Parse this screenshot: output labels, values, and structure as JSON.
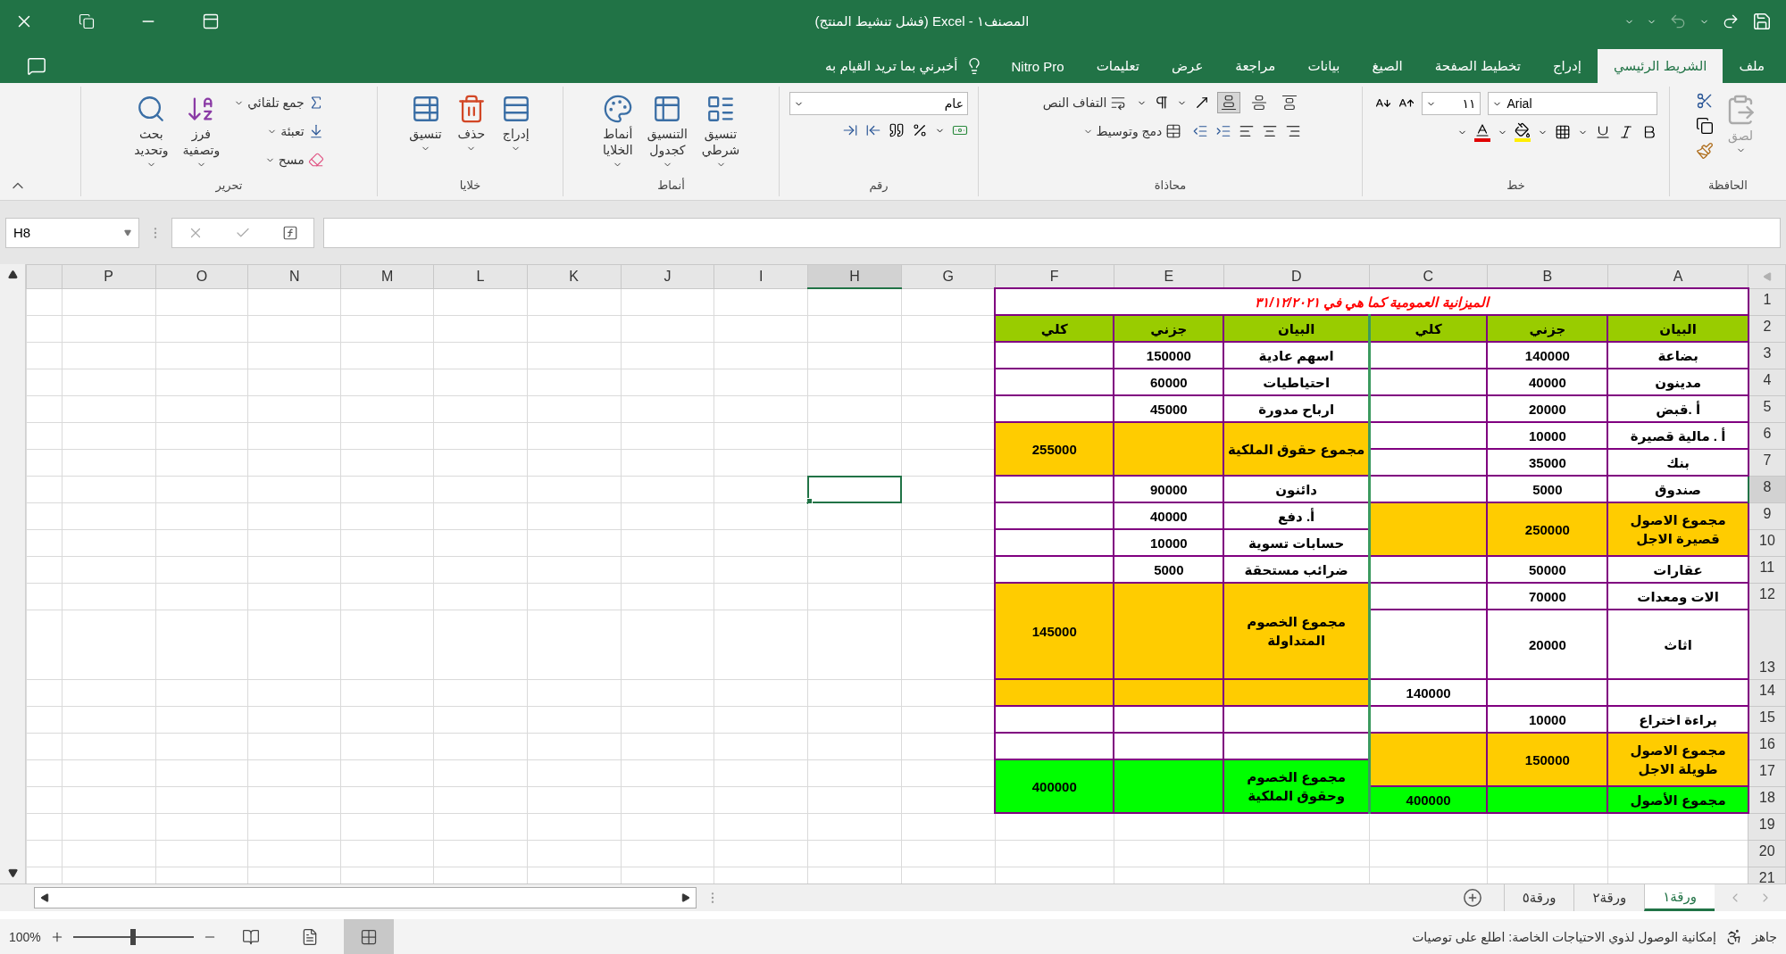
{
  "window": {
    "title": "المصنف١ - Excel (فشل تنشيط المنتج)",
    "undo": {
      "disabled": true
    }
  },
  "tabs": [
    {
      "label": "ملف",
      "selected": false
    },
    {
      "label": "الشريط الرئيسي",
      "selected": true
    },
    {
      "label": "إدراج",
      "selected": false
    },
    {
      "label": "تخطيط الصفحة",
      "selected": false
    },
    {
      "label": "الصيغ",
      "selected": false
    },
    {
      "label": "بيانات",
      "selected": false
    },
    {
      "label": "مراجعة",
      "selected": false
    },
    {
      "label": "عرض",
      "selected": false
    },
    {
      "label": "تعليمات",
      "selected": false
    },
    {
      "label": "Nitro Pro",
      "selected": false
    }
  ],
  "tell_me": {
    "label": "أخبرني بما تريد القيام به"
  },
  "ribbon": {
    "groups": [
      {
        "kind": "clipboard",
        "label": "الحافظة",
        "buttons": [
          {
            "label": "لصق",
            "disabled": true
          }
        ]
      },
      {
        "kind": "font",
        "label": "خط",
        "font": "Arial",
        "size": "١١"
      },
      {
        "kind": "alignment",
        "label": "محاذاة",
        "buttons": [
          {
            "label": "التفاف النص"
          },
          {
            "label": "دمج وتوسيط"
          }
        ]
      },
      {
        "kind": "number",
        "label": "رقم",
        "format": "عام"
      },
      {
        "kind": "styles",
        "label": "أنماط",
        "buttons": [
          {
            "label": "تنسيق\nشرطي"
          },
          {
            "label": "التنسيق\nكجدول"
          },
          {
            "label": "أنماط\nالخلايا"
          }
        ]
      },
      {
        "kind": "cells",
        "label": "خلايا",
        "buttons": [
          {
            "label": "إدراج"
          },
          {
            "label": "حذف"
          },
          {
            "label": "تنسيق"
          }
        ]
      },
      {
        "kind": "editing",
        "label": "تحرير",
        "buttons": [
          {
            "label": "جمع تلقائي"
          },
          {
            "label": "تعبئة"
          },
          {
            "label": "مسح"
          },
          {
            "label": "فرز\nوتصفية"
          },
          {
            "label": "بحث\nوتحديد"
          }
        ]
      }
    ]
  },
  "formula_bar": {
    "name_box": "H8"
  },
  "sheet": {
    "columns": [
      {
        "label": "A",
        "selected": false
      },
      {
        "label": "B",
        "selected": false
      },
      {
        "label": "C",
        "selected": false
      },
      {
        "label": "D",
        "selected": false
      },
      {
        "label": "E",
        "selected": false
      },
      {
        "label": "F",
        "selected": false
      },
      {
        "label": "G",
        "selected": false
      },
      {
        "label": "H",
        "selected": true
      },
      {
        "label": "I",
        "selected": false
      },
      {
        "label": "J",
        "selected": false
      },
      {
        "label": "K",
        "selected": false
      },
      {
        "label": "L",
        "selected": false
      },
      {
        "label": "M",
        "selected": false
      },
      {
        "label": "N",
        "selected": false
      },
      {
        "label": "O",
        "selected": false
      },
      {
        "label": "P",
        "selected": false
      }
    ],
    "rows": [
      {
        "label": "1",
        "selected": false,
        "cells": [
          {
            "kind": "title",
            "text": "الميزانية العمومية كما هي في ٣١/١٢/٢٠٢١"
          },
          {
            "kind": "merge_row"
          },
          {
            "kind": "merge_row"
          },
          {
            "kind": "merge_row"
          },
          {
            "kind": "merge_row"
          },
          {
            "kind": "merge_row"
          }
        ]
      },
      {
        "label": "2",
        "selected": false,
        "cells": [
          {
            "kind": "text",
            "text": "البيان",
            "color": "#99cc00"
          },
          {
            "kind": "text",
            "text": "جزني",
            "color": "#99cc00"
          },
          {
            "kind": "text",
            "text": "كلي",
            "color": "#99cc00"
          },
          {
            "kind": "text",
            "text": "البيان",
            "color": "#99cc00"
          },
          {
            "kind": "text",
            "text": "جزني",
            "color": "#99cc00"
          },
          {
            "kind": "text",
            "text": "كلي",
            "color": "#99cc00"
          }
        ]
      },
      {
        "label": "3",
        "selected": false,
        "cells": [
          {
            "kind": "text",
            "text": "بضاعة"
          },
          {
            "kind": "text",
            "text": "140000"
          },
          {
            "kind": "blank"
          },
          {
            "kind": "text",
            "text": "اسهم عادية"
          },
          {
            "kind": "text",
            "text": "150000"
          },
          {
            "kind": "blank"
          }
        ]
      },
      {
        "label": "4",
        "selected": false,
        "cells": [
          {
            "kind": "text",
            "text": "مدينون"
          },
          {
            "kind": "text",
            "text": "40000"
          },
          {
            "kind": "blank"
          },
          {
            "kind": "text",
            "text": "احتياطيات"
          },
          {
            "kind": "text",
            "text": "60000"
          },
          {
            "kind": "blank"
          }
        ]
      },
      {
        "label": "5",
        "selected": false,
        "cells": [
          {
            "kind": "text",
            "text": "أ .قبض"
          },
          {
            "kind": "text",
            "text": "20000"
          },
          {
            "kind": "blank"
          },
          {
            "kind": "text",
            "text": "ارباح مدورة"
          },
          {
            "kind": "text",
            "text": "45000"
          },
          {
            "kind": "blank"
          }
        ]
      },
      {
        "label": "6",
        "selected": false,
        "cells": [
          {
            "kind": "text",
            "text": "أ . مالية قصيرة"
          },
          {
            "kind": "text",
            "text": "10000"
          },
          {
            "kind": "blank"
          },
          {
            "kind": "text",
            "text": "مجموع حقوق الملكية",
            "color": "#ffcc00"
          },
          {
            "kind": "text",
            "color": "#ffcc00"
          },
          {
            "kind": "text",
            "text": "255000",
            "color": "#ffcc00"
          }
        ]
      },
      {
        "label": "7",
        "selected": false,
        "cells": [
          {
            "kind": "text",
            "text": "بنك"
          },
          {
            "kind": "text",
            "text": "35000"
          },
          {
            "kind": "blank"
          },
          {
            "kind": "merge_col"
          },
          {
            "kind": "merge_col"
          },
          {
            "kind": "merge_col"
          }
        ]
      },
      {
        "label": "8",
        "selected": true,
        "cells": [
          {
            "kind": "text",
            "text": "صندوق"
          },
          {
            "kind": "text",
            "text": "5000"
          },
          {
            "kind": "blank"
          },
          {
            "kind": "text",
            "text": "دائنون"
          },
          {
            "kind": "text",
            "text": "90000"
          },
          {
            "kind": "blank"
          }
        ]
      },
      {
        "label": "9",
        "selected": false,
        "cells": [
          {
            "kind": "text",
            "text": "مجموع الاصول\nقصيرة الاجل",
            "color": "#ffcc00"
          },
          {
            "kind": "text",
            "text": "250000",
            "color": "#ffcc00"
          },
          {
            "kind": "text",
            "color": "#ffcc00"
          },
          {
            "kind": "text",
            "text": "أ. دفع"
          },
          {
            "kind": "text",
            "text": "40000"
          },
          {
            "kind": "blank"
          }
        ]
      },
      {
        "label": "10",
        "selected": false,
        "cells": [
          {
            "kind": "merge_col"
          },
          {
            "kind": "merge_col"
          },
          {
            "kind": "merge_col"
          },
          {
            "kind": "text",
            "text": "حسابات تسوية"
          },
          {
            "kind": "text",
            "text": "10000"
          },
          {
            "kind": "blank"
          }
        ]
      },
      {
        "label": "11",
        "selected": false,
        "cells": [
          {
            "kind": "text",
            "text": "عقارات"
          },
          {
            "kind": "text",
            "text": "50000"
          },
          {
            "kind": "blank"
          },
          {
            "kind": "text",
            "text": "ضرائب مستحقة"
          },
          {
            "kind": "text",
            "text": "5000"
          },
          {
            "kind": "blank"
          }
        ]
      },
      {
        "label": "12",
        "selected": false,
        "cells": [
          {
            "kind": "text",
            "text": "الات ومعدات"
          },
          {
            "kind": "text",
            "text": "70000"
          },
          {
            "kind": "blank"
          },
          {
            "kind": "text",
            "text": "مجموع الخصوم\nالمتداولة",
            "color": "#ffcc00"
          },
          {
            "kind": "text",
            "color": "#ffcc00"
          },
          {
            "kind": "text",
            "text": "145000",
            "color": "#ffcc00"
          }
        ]
      },
      {
        "label": "13",
        "selected": false,
        "cells": [
          {
            "kind": "text",
            "text": "اثاث"
          },
          {
            "kind": "text",
            "text": "20000"
          },
          {
            "kind": "blank"
          },
          {
            "kind": "merge_col"
          },
          {
            "kind": "merge_col"
          },
          {
            "kind": "merge_col"
          }
        ]
      },
      {
        "label": "14",
        "selected": false,
        "cells": [
          {
            "kind": "blank"
          },
          {
            "kind": "blank"
          },
          {
            "kind": "text",
            "text": "140000"
          },
          {
            "kind": "text",
            "color": "#ffcc00"
          },
          {
            "kind": "text",
            "color": "#ffcc00"
          },
          {
            "kind": "text",
            "color": "#ffcc00"
          }
        ]
      },
      {
        "label": "15",
        "selected": false,
        "cells": [
          {
            "kind": "text",
            "text": "براءة اختراع"
          },
          {
            "kind": "text",
            "text": "10000"
          },
          {
            "kind": "blank"
          },
          {
            "kind": "blank"
          },
          {
            "kind": "blank"
          },
          {
            "kind": "blank"
          }
        ]
      },
      {
        "label": "16",
        "selected": false,
        "cells": [
          {
            "kind": "text",
            "text": "مجموع الاصول\nطويلة الاجل",
            "color": "#ffcc00"
          },
          {
            "kind": "text",
            "text": "150000",
            "color": "#ffcc00"
          },
          {
            "kind": "text",
            "color": "#ffcc00"
          },
          {
            "kind": "blank"
          },
          {
            "kind": "blank"
          },
          {
            "kind": "blank"
          }
        ]
      },
      {
        "label": "17",
        "selected": false,
        "cells": [
          {
            "kind": "merge_col"
          },
          {
            "kind": "merge_col"
          },
          {
            "kind": "merge_col"
          },
          {
            "kind": "text",
            "text": "مجموع الخصوم\nوحقوق الملكية",
            "color": "#00ff00"
          },
          {
            "kind": "text",
            "color": "#00ff00"
          },
          {
            "kind": "text",
            "text": "400000",
            "color": "#00ff00"
          }
        ]
      },
      {
        "label": "18",
        "selected": false,
        "cells": [
          {
            "kind": "text",
            "text": "مجموع الأصول",
            "color": "#00ff00"
          },
          {
            "kind": "text",
            "color": "#00ff00"
          },
          {
            "kind": "text",
            "text": "400000",
            "color": "#00ff00"
          },
          {
            "kind": "merge_col"
          },
          {
            "kind": "merge_col"
          },
          {
            "kind": "merge_col"
          }
        ]
      },
      {
        "label": "19",
        "selected": false
      },
      {
        "label": "20",
        "selected": false
      },
      {
        "label": "21",
        "selected": false
      }
    ]
  },
  "sheet_tabs": [
    {
      "label": "ورقة١",
      "selected": true
    },
    {
      "label": "ورقة٢",
      "selected": false
    },
    {
      "label": "ورقة٥",
      "selected": false
    }
  ],
  "status_bar": {
    "status": "جاهز",
    "accessibility": "إمكانية الوصول لذوي الاحتياجات الخاصة: اطلع على توصيات",
    "views": [
      {
        "selected": true
      },
      {
        "selected": false
      },
      {
        "selected": false
      }
    ],
    "zoom": {
      "level": 0.5,
      "reading": "100%"
    }
  }
}
